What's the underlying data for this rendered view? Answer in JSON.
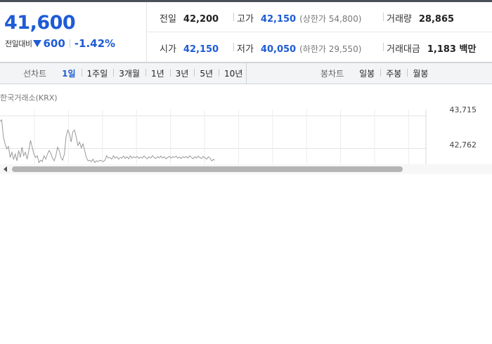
{
  "quote": {
    "price": "41,600",
    "change_label": "전일대비",
    "change_direction_icon": "down-triangle-icon",
    "change_value": "600",
    "change_percent": "-1.42%",
    "colors": {
      "down": "#1e5bd6"
    }
  },
  "stats": {
    "prev_close": {
      "label": "전일",
      "value": "42,200"
    },
    "high": {
      "label": "고가",
      "value": "42,150",
      "sub": "(상한가 54,800)"
    },
    "volume": {
      "label": "거래량",
      "value": "28,865"
    },
    "open": {
      "label": "시가",
      "value": "42,150"
    },
    "low": {
      "label": "저가",
      "value": "40,050",
      "sub": "(하한가 29,550)"
    },
    "amount": {
      "label": "거래대금",
      "value": "1,183 백만"
    }
  },
  "tabs": {
    "line_chart": {
      "title": "선차트",
      "items": [
        "1일",
        "1주일",
        "3개월",
        "1년",
        "3년",
        "5년",
        "10년"
      ],
      "active": "1일"
    },
    "candle_chart": {
      "title": "봉차트",
      "items": [
        "일봉",
        "주봉",
        "월봉"
      ]
    }
  },
  "chart": {
    "exchange_label": "한국거래소(KRX)",
    "y_ticks": [
      "43,715",
      "42,762"
    ]
  },
  "chart_data": {
    "type": "line",
    "title": "",
    "xlabel": "",
    "ylabel": "",
    "ylim": [
      42300,
      43900
    ],
    "y_ticks": [
      43715,
      42762
    ],
    "series": [
      {
        "values": [
          43550,
          43600,
          43100,
          42900,
          42750,
          42820,
          42500,
          42650,
          42450,
          42600,
          42400,
          42700,
          42500,
          42800,
          42550,
          42650,
          42450,
          42700,
          43000,
          42800,
          42600,
          42500,
          42550,
          42350,
          42420,
          42380,
          42550,
          42450,
          42600,
          42700,
          42620,
          42480,
          42400,
          42550,
          42800,
          42700,
          42500,
          42420,
          42600,
          43100,
          43300,
          43200,
          42950,
          43250,
          43300,
          43100,
          42850,
          42950,
          42780,
          42900,
          42700,
          42500,
          42400,
          42420,
          42380,
          42450,
          42350,
          42400,
          42380,
          42420,
          42400,
          42380,
          42420,
          42550,
          42480,
          42500,
          42450,
          42550,
          42480,
          42520,
          42450,
          42500,
          42480,
          42540,
          42470,
          42520,
          42460,
          42550,
          42480,
          42520,
          42490,
          42530,
          42470,
          42510,
          42480,
          42540,
          42500,
          42460,
          42520,
          42480,
          42550,
          42500,
          42470,
          42520,
          42490,
          42540,
          42480,
          42520,
          42460,
          42500,
          42530,
          42480,
          42520,
          42500,
          42540,
          42480,
          42510,
          42470,
          42520,
          42490,
          42530,
          42480,
          42550,
          42500,
          42460,
          42520,
          42480,
          42540,
          42500,
          42470,
          42530,
          42490,
          42450,
          42520,
          42480,
          42400,
          42440,
          42420
        ]
      }
    ]
  },
  "scrollbar": {
    "left_arrow_icon": "chevron-left-icon"
  }
}
